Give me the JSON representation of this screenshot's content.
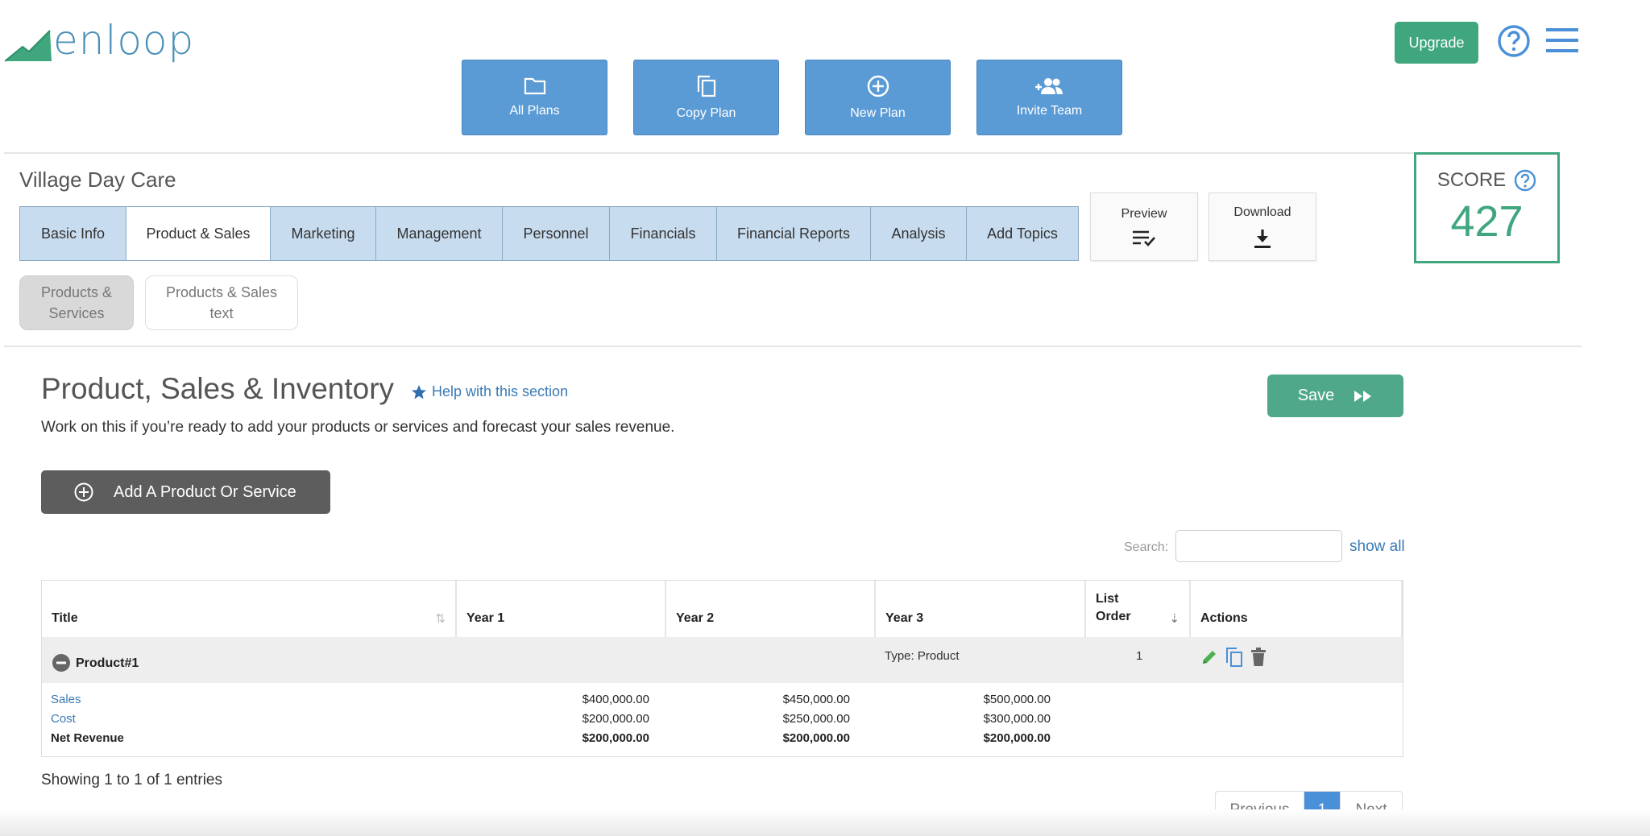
{
  "brand": {
    "logo_text": "enloop",
    "color": "#4a90b8"
  },
  "top_actions": [
    {
      "label": "All Plans",
      "icon": "folder-icon"
    },
    {
      "label": "Copy Plan",
      "icon": "copy-icon"
    },
    {
      "label": "New Plan",
      "icon": "plus-circle-icon"
    },
    {
      "label": "Invite Team",
      "icon": "group-add-icon"
    }
  ],
  "header": {
    "upgrade_label": "Upgrade"
  },
  "plan": {
    "title": "Village Day Care"
  },
  "tabs": [
    {
      "label": "Basic Info"
    },
    {
      "label": "Product & Sales",
      "active": true
    },
    {
      "label": "Marketing"
    },
    {
      "label": "Management"
    },
    {
      "label": "Personnel"
    },
    {
      "label": "Financials"
    },
    {
      "label": "Financial Reports"
    },
    {
      "label": "Analysis"
    },
    {
      "label": "Add Topics"
    }
  ],
  "preview": {
    "label": "Preview"
  },
  "download": {
    "label": "Download"
  },
  "score": {
    "label": "SCORE",
    "value": "427"
  },
  "subtabs": [
    {
      "line1": "Products &",
      "line2": "Services",
      "active": true
    },
    {
      "line1": "Products & Sales",
      "line2": "text"
    }
  ],
  "section": {
    "title": "Product, Sales & Inventory",
    "help": "Help with this section",
    "description": "Work on this if you’re ready to add your products or services and forecast your sales revenue.",
    "save_label": "Save",
    "add_label": "Add A Product Or Service"
  },
  "search": {
    "label": "Search:",
    "show_all": "show all"
  },
  "table": {
    "headers": {
      "title": "Title",
      "year1": "Year 1",
      "year2": "Year 2",
      "year3": "Year 3",
      "list_order_1": "List",
      "list_order_2": "Order",
      "actions": "Actions"
    },
    "group": {
      "name": "Product#1",
      "type": "Type: Product",
      "order": "1"
    },
    "rows": [
      {
        "label": "Sales",
        "y1": "$400,000.00",
        "y2": "$450,000.00",
        "y3": "$500,000.00"
      },
      {
        "label": "Cost",
        "y1": "$200,000.00",
        "y2": "$250,000.00",
        "y3": "$300,000.00"
      },
      {
        "label": "Net Revenue",
        "y1": "$200,000.00",
        "y2": "$200,000.00",
        "y3": "$200,000.00"
      }
    ]
  },
  "footer": {
    "showing": "Showing 1 to 1 of 1 entries"
  },
  "pagination": {
    "previous": "Previous",
    "current": "1",
    "next": "Next"
  },
  "colors": {
    "accent_green": "#3fa67e",
    "button_blue": "#5b9bd5",
    "link_blue": "#3a7ab5"
  }
}
